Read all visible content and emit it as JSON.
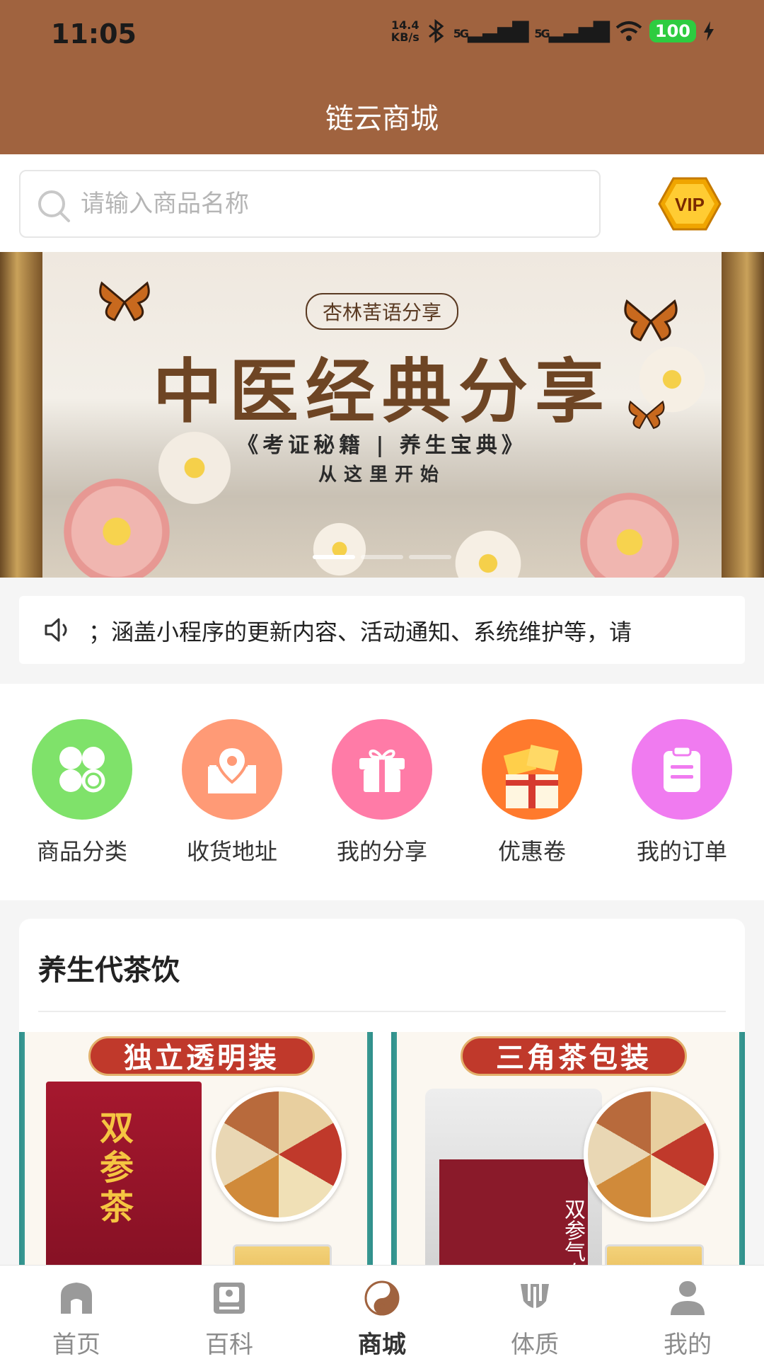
{
  "status_bar": {
    "time": "11:05",
    "net_speed_value": "14.4",
    "net_speed_unit": "KB/s",
    "signal_1": "5G",
    "signal_2": "5G",
    "battery": "100"
  },
  "header": {
    "title": "链云商城"
  },
  "search": {
    "placeholder": "请输入商品名称"
  },
  "vip": {
    "label": "VIP"
  },
  "banner": {
    "top_label": "杏林䒷语分享",
    "title": "中医经典分享",
    "subtitle": "《考证秘籍 | 养生宝典》",
    "subtitle2": "从这里开始",
    "page_count": 3,
    "active_page": 1
  },
  "notice": {
    "text": "；涵盖小程序的更新内容、活动通知、系统维护等，请"
  },
  "quick_menu": [
    {
      "label": "商品分类",
      "icon": "clover-icon",
      "color": "#7fe26a"
    },
    {
      "label": "收货地址",
      "icon": "location-icon",
      "color": "#ff9a76"
    },
    {
      "label": "我的分享",
      "icon": "gift-icon",
      "color": "#ff7ba7"
    },
    {
      "label": "优惠卷",
      "icon": "coupon-icon",
      "color": "#ff7a2d"
    },
    {
      "label": "我的订单",
      "icon": "order-icon",
      "color": "#f07bf0"
    }
  ],
  "section": {
    "title": "养生代茶饮",
    "products": [
      {
        "banner": "独立透明装",
        "box_text": "双参茶"
      },
      {
        "banner": "三角茶包装",
        "box_text": "双参气血茶"
      }
    ]
  },
  "tabbar": [
    {
      "label": "首页",
      "icon": "home-icon",
      "active": false
    },
    {
      "label": "百科",
      "icon": "book-icon",
      "active": false
    },
    {
      "label": "商城",
      "icon": "yin-yang-icon",
      "active": true
    },
    {
      "label": "体质",
      "icon": "body-icon",
      "active": false
    },
    {
      "label": "我的",
      "icon": "user-icon",
      "active": false
    }
  ],
  "colors": {
    "header": "#a0633f",
    "active_tab": "#333333",
    "inactive_tab": "#8c8c8c"
  }
}
